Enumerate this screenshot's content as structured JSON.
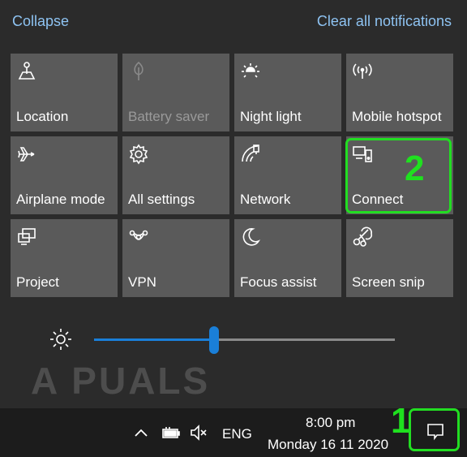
{
  "header": {
    "collapse_label": "Collapse",
    "clear_label": "Clear all notifications"
  },
  "tiles": [
    {
      "label": "Location",
      "icon": "location-icon",
      "enabled": true
    },
    {
      "label": "Battery saver",
      "icon": "battery-saver-icon",
      "enabled": false
    },
    {
      "label": "Night light",
      "icon": "night-light-icon",
      "enabled": true
    },
    {
      "label": "Mobile hotspot",
      "icon": "mobile-hotspot-icon",
      "enabled": true
    },
    {
      "label": "Airplane mode",
      "icon": "airplane-icon",
      "enabled": true
    },
    {
      "label": "All settings",
      "icon": "gear-icon",
      "enabled": true
    },
    {
      "label": "Network",
      "icon": "network-icon",
      "enabled": true
    },
    {
      "label": "Connect",
      "icon": "connect-icon",
      "enabled": true
    },
    {
      "label": "Project",
      "icon": "project-icon",
      "enabled": true
    },
    {
      "label": "VPN",
      "icon": "vpn-icon",
      "enabled": true
    },
    {
      "label": "Focus assist",
      "icon": "moon-icon",
      "enabled": true
    },
    {
      "label": "Screen snip",
      "icon": "scissors-icon",
      "enabled": true
    }
  ],
  "annotations": {
    "step_1": "1",
    "step_2": "2",
    "highlight_color": "#22dd22"
  },
  "brightness": {
    "level_percent": 40,
    "accent": "#1a7fd8"
  },
  "watermark": "A PUALS",
  "taskbar": {
    "language": "ENG",
    "time": "8:00 pm",
    "date": "Monday 16 11 2020"
  }
}
